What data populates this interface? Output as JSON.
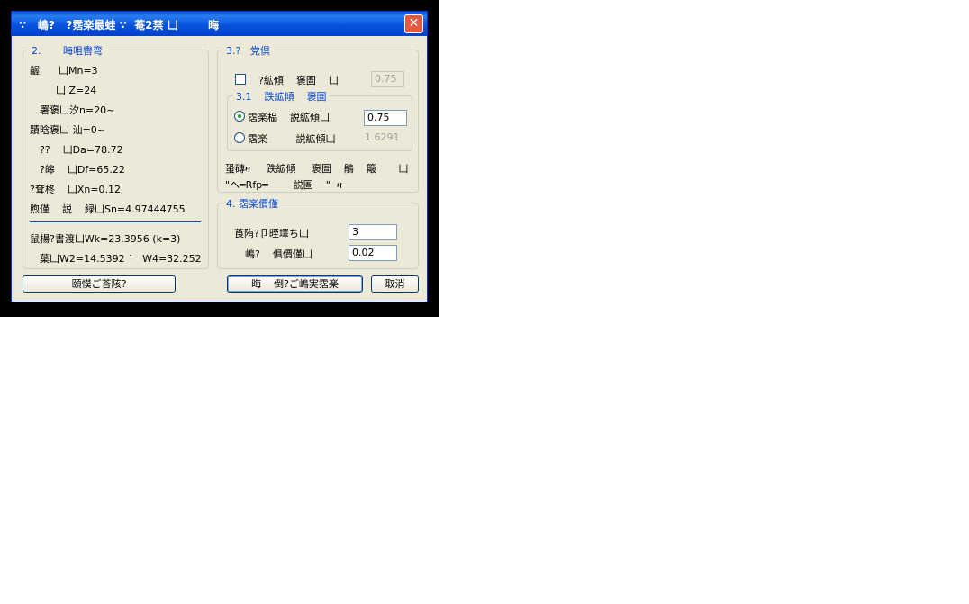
{
  "window": {
    "title": "∵   嶋?   ?霑楽最蛙 ∵  菴2禁 凵        晦",
    "close_glyph": "✕"
  },
  "group2": {
    "legend": "2.       晦咀轡弯",
    "lines": [
      "齷      凵Mn=3",
      "凵 Z=24",
      "署褒凵汐n=20~",
      "蹟晗褒凵 汕=0~",
      "??    凵Da=78.72",
      "?皞    凵Df=65.22",
      "?耷柊    凵Xn=0.12",
      "煦僅    説    緑凵Sn=4.97444755"
    ],
    "lines2": [
      "鼠楊?書渡凵Wk=23.3956 (k=3)",
      "葉凵W2=14.5392 ˙   W4=32.252"
    ]
  },
  "group3": {
    "legend": "3.?   党倶",
    "checkbox_label": "?絋傾    褒圄    凵",
    "checkbox_value": "0.75",
    "subgroup": {
      "legend": "3.1    跌絋傾    褒圄",
      "radio1_label": "霑楽榀    説絋傾凵",
      "radio1_value": "0.75",
      "radio2_label": "霑楽         説絋傾凵",
      "radio2_value": "1.6291"
    },
    "note1": "蛩磚ዛ     跌絋傾     褒圄    鵑    簸       凵",
    "note2": "\"ヘ═Rfp═        説圄    \"  ዛ"
  },
  "group4": {
    "legend": "4. 霑楽價僅",
    "row1_label": "莨陏?卩晊墿ち凵",
    "row1_value": "3",
    "row2_label": "嶋?    俱價僅凵",
    "row2_value": "0.02"
  },
  "buttons": {
    "left": "頤慔ご荅陔?",
    "middle": "晦    倒?ご嶋実霑楽",
    "cancel": "取消"
  }
}
